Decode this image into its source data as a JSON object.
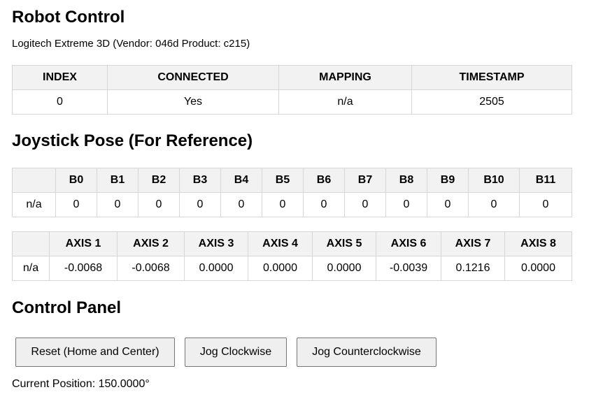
{
  "title": "Robot Control",
  "device": "Logitech Extreme 3D (Vendor: 046d Product: c215)",
  "info_table": {
    "headers": [
      "INDEX",
      "CONNECTED",
      "MAPPING",
      "TIMESTAMP"
    ],
    "row": [
      "0",
      "Yes",
      "n/a",
      "2505"
    ]
  },
  "pose_title": "Joystick Pose (For Reference)",
  "buttons_table": {
    "headers": [
      "",
      "B0",
      "B1",
      "B2",
      "B3",
      "B4",
      "B5",
      "B6",
      "B7",
      "B8",
      "B9",
      "B10",
      "B11"
    ],
    "row": [
      "n/a",
      "0",
      "0",
      "0",
      "0",
      "0",
      "0",
      "0",
      "0",
      "0",
      "0",
      "0",
      "0"
    ]
  },
  "axes_table": {
    "headers": [
      "",
      "AXIS 1",
      "AXIS 2",
      "AXIS 3",
      "AXIS 4",
      "AXIS 5",
      "AXIS 6",
      "AXIS 7",
      "AXIS 8"
    ],
    "row": [
      "n/a",
      "-0.0068",
      "-0.0068",
      "0.0000",
      "0.0000",
      "0.0000",
      "-0.0039",
      "0.1216",
      "0.0000"
    ]
  },
  "control_title": "Control Panel",
  "controls": {
    "reset": "Reset (Home and Center)",
    "jog_cw": "Jog Clockwise",
    "jog_ccw": "Jog Counterclockwise"
  },
  "current_position": "Current Position: 150.0000°"
}
